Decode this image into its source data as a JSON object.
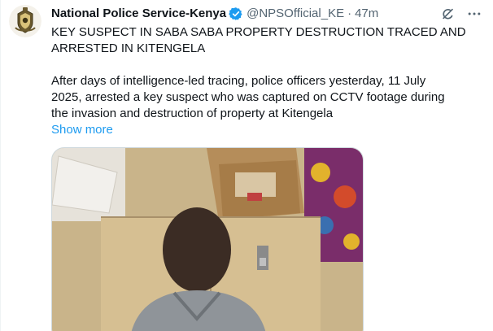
{
  "author": {
    "name": "National Police Service-Kenya",
    "handle": "@NPSOfficial_KE",
    "separator": "·",
    "time": "47m"
  },
  "icons": {
    "avatar": "police-crest-icon",
    "verified": "verified-badge-icon",
    "grok": "grok-icon",
    "more": "more-dots-icon"
  },
  "post": {
    "headline": "KEY SUSPECT IN SABA SABA PROPERTY DESTRUCTION TRACED AND\nARRESTED IN KITENGELA",
    "body": "After days of intelligence-led tracing, police officers yesterday, 11 July\n2025, arrested a key suspect who was captured on CCTV footage during\nthe invasion and destruction of property at Kitengela",
    "show_more": "Show more"
  },
  "colors": {
    "link": "#1d9bf0",
    "verified": "#1d9bf0",
    "secondary_text": "#536471"
  }
}
